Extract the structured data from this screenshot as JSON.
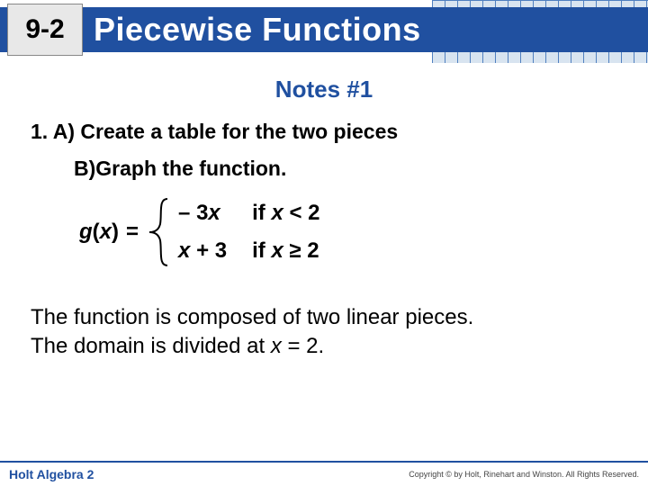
{
  "header": {
    "section_number": "9-2",
    "title": "Piecewise Functions"
  },
  "notes": {
    "heading": "Notes #1",
    "problem_stem": "1. A) Create a table for the two pieces",
    "part_b": "B)Graph the function.",
    "function_label_g": "g",
    "function_label_x": "x",
    "equals": "=",
    "case1_expr": "– 3",
    "case1_var": "x",
    "case1_cond_prefix": "if ",
    "case1_cond_var": "x",
    "case1_cond_rest": " < 2",
    "case2_var": "x",
    "case2_rest": " + 3",
    "case2_cond_prefix": "if ",
    "case2_cond_var": "x",
    "case2_cond_rest": " ≥ 2",
    "explanation_line1": "The function is composed of two linear pieces.",
    "explanation_line2_a": "The domain is divided at ",
    "explanation_line2_var": "x",
    "explanation_line2_b": " = 2."
  },
  "footer": {
    "left": "Holt Algebra 2",
    "right": "Copyright © by Holt, Rinehart and Winston. All Rights Reserved."
  }
}
